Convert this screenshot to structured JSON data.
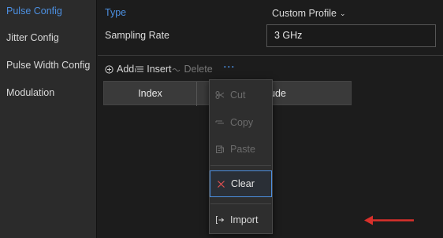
{
  "sidebar": {
    "items": [
      {
        "label": "Pulse Config",
        "active": true
      },
      {
        "label": "Jitter Config",
        "active": false
      },
      {
        "label": "Pulse Width Config",
        "active": false
      },
      {
        "label": "Modulation",
        "active": false
      }
    ]
  },
  "form": {
    "type_label": "Type",
    "type_value": "Custom Profile",
    "sampling_label": "Sampling Rate",
    "sampling_value": "3 GHz"
  },
  "toolbar": {
    "add_label": "Add",
    "insert_label": "Insert",
    "delete_label": "Delete",
    "more_label": "···"
  },
  "table": {
    "columns": [
      "Index",
      "Amplitude"
    ],
    "visible_column_text": [
      "Index",
      "litude"
    ]
  },
  "context_menu": {
    "items": [
      {
        "label": "Cut",
        "icon": "scissors-icon",
        "enabled": false
      },
      {
        "label": "Copy",
        "icon": "copy-icon",
        "enabled": false
      },
      {
        "label": "Paste",
        "icon": "paste-icon",
        "enabled": false
      },
      {
        "label": "Clear",
        "icon": "close-icon",
        "enabled": true,
        "highlighted": true
      },
      {
        "label": "Import",
        "icon": "import-icon",
        "enabled": true
      }
    ]
  },
  "colors": {
    "accent": "#4c8fe0",
    "clear_icon": "#e05050",
    "arrow": "#d9302b"
  }
}
